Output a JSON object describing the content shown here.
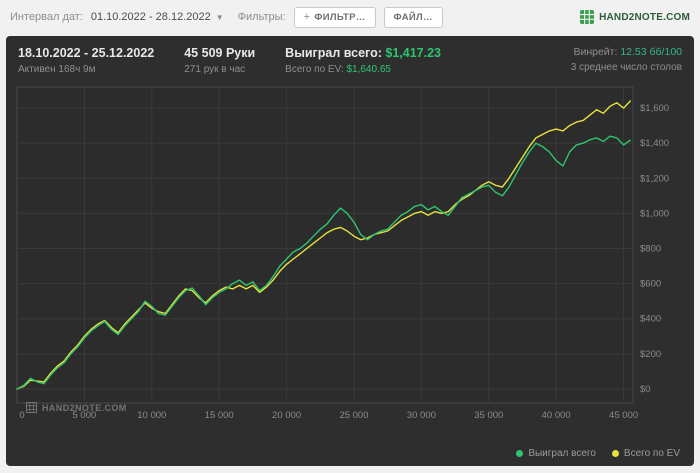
{
  "topbar": {
    "interval_label": "Интервал дат:",
    "interval_value": "01.10.2022 - 28.12.2022",
    "filters_label": "Фильтры:",
    "filter_button": "ФИЛЬТР…",
    "file_button": "ФАЙЛ…",
    "brand": "HAND2NOTE.COM"
  },
  "header": {
    "date_range": "18.10.2022 - 25.12.2022",
    "active_time": "Активен 168ч 9м",
    "hands": "45 509 Руки",
    "hands_per_hour": "271 рук в час",
    "won_label": "Выиграл всего:",
    "won_value": "$1,417.23",
    "ev_label": "Всего по EV:",
    "ev_value": "$1,640.65",
    "winrate_label": "Винрейт:",
    "winrate_value": "12.53",
    "winrate_unit": "бб/100",
    "tables_avg": "3 среднее число столов"
  },
  "watermark": "HAND2NOTE.COM",
  "legend": [
    {
      "label": "Выиграл всего",
      "color": "#2fc56f"
    },
    {
      "label": "Всего по EV",
      "color": "#e6e13c"
    }
  ],
  "colors": {
    "panel_bg": "#2e2e2e",
    "accent_green": "#2fc56f",
    "accent_yellow": "#e6e13c",
    "winrate_teal": "#2eb98b"
  },
  "chart_data": {
    "type": "line",
    "title": "",
    "xlabel": "",
    "ylabel": "",
    "xlim": [
      0,
      45700
    ],
    "ylim": [
      -80,
      1720
    ],
    "grid": true,
    "legend_position": "bottom-right",
    "colors": {
      "plot_bg": "#2c2c2c",
      "border": "#474747",
      "grid": "#3a3a3a",
      "tick": "#8c8c8c"
    },
    "x_ticks": [
      {
        "v": 0,
        "label": "0"
      },
      {
        "v": 5000,
        "label": "5 000"
      },
      {
        "v": 10000,
        "label": "10 000"
      },
      {
        "v": 15000,
        "label": "15 000"
      },
      {
        "v": 20000,
        "label": "20 000"
      },
      {
        "v": 25000,
        "label": "25 000"
      },
      {
        "v": 30000,
        "label": "30 000"
      },
      {
        "v": 35000,
        "label": "35 000"
      },
      {
        "v": 40000,
        "label": "40 000"
      },
      {
        "v": 45000,
        "label": "45 000"
      }
    ],
    "y_ticks": [
      {
        "v": 0,
        "label": "$0"
      },
      {
        "v": 200,
        "label": "$200"
      },
      {
        "v": 400,
        "label": "$400"
      },
      {
        "v": 600,
        "label": "$600"
      },
      {
        "v": 800,
        "label": "$800"
      },
      {
        "v": 1000,
        "label": "$1,000"
      },
      {
        "v": 1200,
        "label": "$1,200"
      },
      {
        "v": 1400,
        "label": "$1,400"
      },
      {
        "v": 1600,
        "label": "$1,600"
      }
    ],
    "x_start": 0,
    "x_step": 500,
    "series": [
      {
        "name": "Всего по EV",
        "color": "#e6e13c",
        "values": [
          0,
          15,
          50,
          45,
          40,
          90,
          130,
          160,
          210,
          250,
          300,
          340,
          370,
          390,
          350,
          320,
          370,
          410,
          450,
          490,
          460,
          440,
          430,
          480,
          530,
          570,
          560,
          520,
          490,
          530,
          560,
          580,
          570,
          590,
          570,
          590,
          550,
          580,
          620,
          670,
          710,
          740,
          770,
          800,
          830,
          860,
          890,
          910,
          920,
          900,
          870,
          850,
          860,
          880,
          890,
          900,
          930,
          960,
          980,
          1000,
          1010,
          990,
          1010,
          1000,
          1010,
          1050,
          1080,
          1100,
          1130,
          1160,
          1180,
          1160,
          1150,
          1200,
          1260,
          1320,
          1380,
          1430,
          1450,
          1470,
          1480,
          1470,
          1500,
          1520,
          1530,
          1560,
          1590,
          1570,
          1610,
          1630,
          1600,
          1640
        ]
      },
      {
        "name": "Выиграл всего",
        "color": "#2fc56f",
        "values": [
          0,
          20,
          60,
          40,
          30,
          80,
          120,
          150,
          200,
          240,
          290,
          330,
          360,
          385,
          340,
          310,
          360,
          400,
          440,
          500,
          470,
          430,
          420,
          470,
          520,
          560,
          575,
          530,
          480,
          520,
          550,
          570,
          600,
          620,
          590,
          610,
          560,
          590,
          640,
          700,
          740,
          780,
          800,
          830,
          870,
          910,
          940,
          990,
          1030,
          1000,
          950,
          880,
          850,
          880,
          900,
          910,
          950,
          990,
          1010,
          1040,
          1050,
          1020,
          1040,
          1010,
          990,
          1040,
          1090,
          1110,
          1130,
          1150,
          1160,
          1120,
          1100,
          1150,
          1220,
          1290,
          1350,
          1400,
          1380,
          1350,
          1300,
          1270,
          1350,
          1390,
          1400,
          1420,
          1430,
          1410,
          1440,
          1430,
          1390,
          1417
        ]
      }
    ]
  }
}
